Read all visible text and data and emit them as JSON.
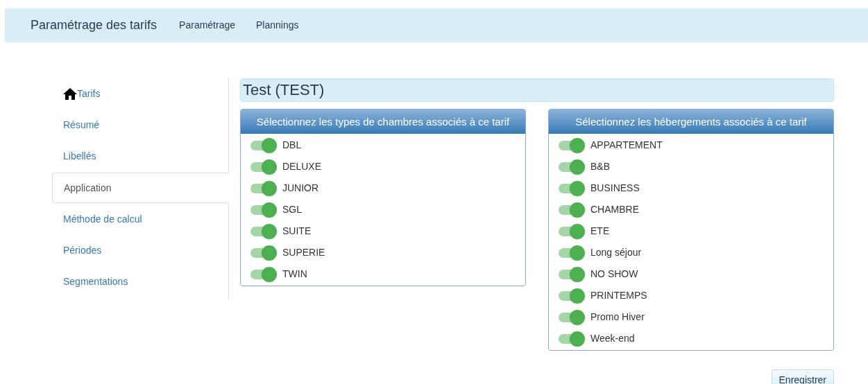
{
  "navbar": {
    "brand": "Paramétrage des tarifs",
    "links": [
      "Paramétrage",
      "Plannings"
    ]
  },
  "sidebar": {
    "items": [
      {
        "label": "Tarifs",
        "kind": "home",
        "selected": false
      },
      {
        "label": "Résumé",
        "kind": "link",
        "selected": false
      },
      {
        "label": "Libellés",
        "kind": "link",
        "selected": false
      },
      {
        "label": "Application",
        "kind": "link",
        "selected": true
      },
      {
        "label": "Méthode de calcul",
        "kind": "link",
        "selected": false
      },
      {
        "label": "Périodes",
        "kind": "link",
        "selected": false
      },
      {
        "label": "Segmentations",
        "kind": "link",
        "selected": false
      }
    ]
  },
  "title": "Test (TEST)",
  "panels": [
    {
      "heading": "Sélectionnez les types de chambres associés à ce tarif",
      "items": [
        {
          "label": "DBL",
          "on": true
        },
        {
          "label": "DELUXE",
          "on": true
        },
        {
          "label": "JUNIOR",
          "on": true
        },
        {
          "label": "SGL",
          "on": true
        },
        {
          "label": "SUITE",
          "on": true
        },
        {
          "label": "SUPERIE",
          "on": true
        },
        {
          "label": "TWIN",
          "on": true
        }
      ]
    },
    {
      "heading": "Sélectionnez les hébergements associés à ce tarif",
      "items": [
        {
          "label": "APPARTEMENT",
          "on": true
        },
        {
          "label": "B&B",
          "on": true
        },
        {
          "label": "BUSINESS",
          "on": true
        },
        {
          "label": "CHAMBRE",
          "on": true
        },
        {
          "label": "ETE",
          "on": true
        },
        {
          "label": "Long séjour",
          "on": true
        },
        {
          "label": "NO SHOW",
          "on": true
        },
        {
          "label": "PRINTEMPS",
          "on": true
        },
        {
          "label": "Promo Hiver",
          "on": true
        },
        {
          "label": "Week-end",
          "on": true
        }
      ]
    }
  ],
  "save_button": "Enregistrer"
}
